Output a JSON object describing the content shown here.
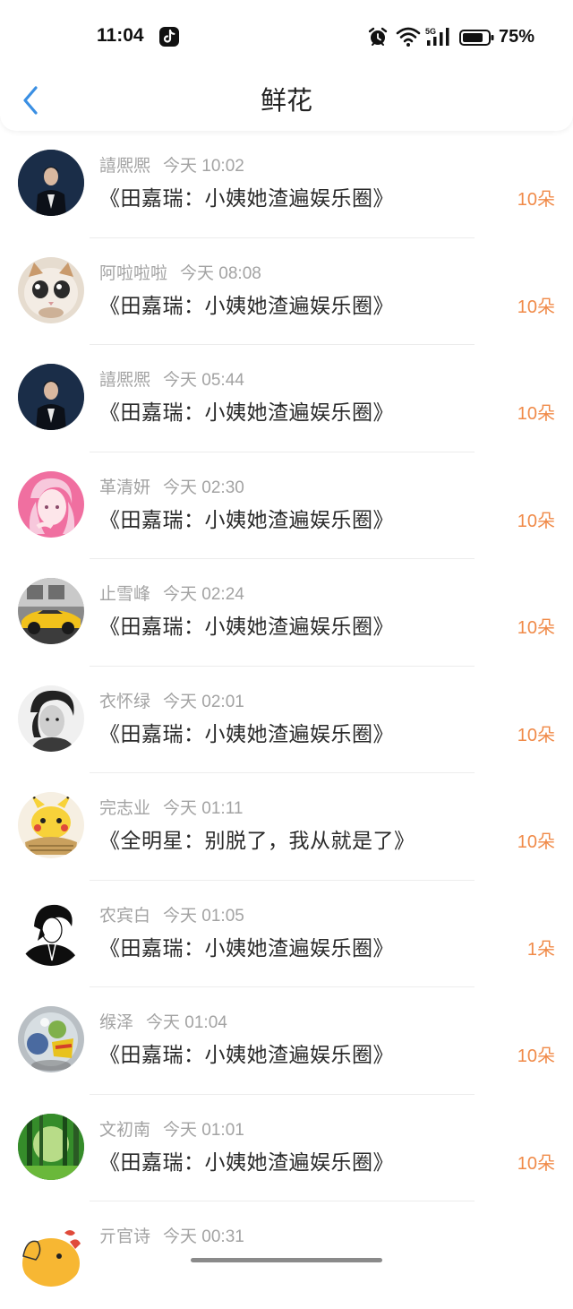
{
  "status_bar": {
    "time": "11:04",
    "battery": "75%",
    "network": "5G"
  },
  "nav": {
    "title": "鲜花"
  },
  "colors": {
    "count": "#f08a48",
    "back": "#3a8fe3"
  },
  "items": [
    {
      "name": "譆熈熈",
      "time": "今天 10:02",
      "title": "《田嘉瑞：小姨她渣遍娱乐圈》",
      "count": "10朵",
      "avatar": "man-in-dark-suit"
    },
    {
      "name": "阿啦啦啦",
      "time": "今天 08:08",
      "title": "《田嘉瑞：小姨她渣遍娱乐圈》",
      "count": "10朵",
      "avatar": "cat-face"
    },
    {
      "name": "譆熈熈",
      "time": "今天 05:44",
      "title": "《田嘉瑞：小姨她渣遍娱乐圈》",
      "count": "10朵",
      "avatar": "man-in-dark-suit"
    },
    {
      "name": "革清妍",
      "time": "今天 02:30",
      "title": "《田嘉瑞：小姨她渣遍娱乐圈》",
      "count": "10朵",
      "avatar": "pink-anime-girl"
    },
    {
      "name": "止雪峰",
      "time": "今天 02:24",
      "title": "《田嘉瑞：小姨她渣遍娱乐圈》",
      "count": "10朵",
      "avatar": "yellow-sports-car"
    },
    {
      "name": "衣怀绿",
      "time": "今天 02:01",
      "title": "《田嘉瑞：小姨她渣遍娱乐圈》",
      "count": "10朵",
      "avatar": "monochrome-portrait"
    },
    {
      "name": "完志业",
      "time": "今天 01:11",
      "title": "《全明星：别脱了，我从就是了》",
      "count": "10朵",
      "avatar": "pikachu"
    },
    {
      "name": "农宾白",
      "time": "今天 01:05",
      "title": "《田嘉瑞：小姨她渣遍娱乐圈》",
      "count": "1朵",
      "avatar": "anime-silhouette"
    },
    {
      "name": "缑泽",
      "time": "今天 01:04",
      "title": "《田嘉瑞：小姨她渣遍娱乐圈》",
      "count": "10朵",
      "avatar": "glass-ball-globe"
    },
    {
      "name": "文初南",
      "time": "今天 01:01",
      "title": "《田嘉瑞：小姨她渣遍娱乐圈》",
      "count": "10朵",
      "avatar": "green-forest"
    },
    {
      "name": "亓官诗",
      "time": "今天 00:31",
      "title": "",
      "count": "",
      "avatar": "cartoon-animal"
    }
  ]
}
